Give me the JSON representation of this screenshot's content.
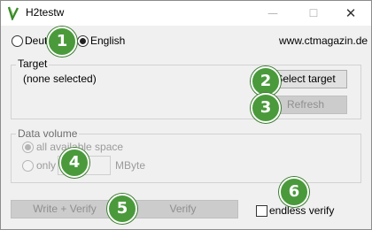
{
  "window": {
    "title": "H2testw",
    "minimize_glyph": "—",
    "maximize_glyph": "☐",
    "close_glyph": "✕",
    "icon": "h2testw-app-icon"
  },
  "language": {
    "options": [
      "Deutsch",
      "English"
    ],
    "visible_text": [
      "Deuts",
      "English"
    ],
    "selected": "English"
  },
  "website": "www.ctmagazin.de",
  "target": {
    "group_label": "Target",
    "selection_text": "(none selected)",
    "select_button": "Select target",
    "refresh_button": "Refresh"
  },
  "data_volume": {
    "group_label": "Data volume",
    "all_label": "all available space",
    "only_label": "only",
    "unit": "MByte",
    "input_value": "",
    "selected": "all available space"
  },
  "actions": {
    "write_verify": "Write + Verify",
    "verify": "Verify",
    "endless_verify": "endless verify",
    "endless_checked": false
  },
  "badges": [
    "1",
    "2",
    "3",
    "4",
    "5",
    "6"
  ],
  "colors": {
    "badge_fill": "#4a9a3b",
    "window_bg": "#f0f0f0",
    "disabled_button": "#cccccc"
  }
}
